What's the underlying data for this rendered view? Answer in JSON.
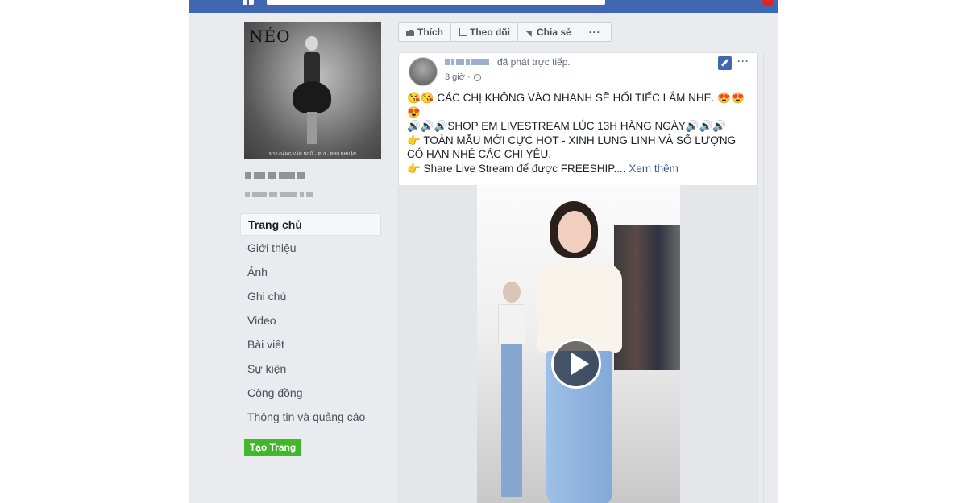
{
  "header": {
    "search_placeholder": ""
  },
  "left_column": {
    "profile_logo_text": "NÉO",
    "profile_caption": "9/10 ĐẶNG VĂN NGỮ · P10 · PHÚ NHUẬN",
    "nav_items": [
      {
        "label": "Trang chủ",
        "active": true
      },
      {
        "label": "Giới thiệu",
        "active": false
      },
      {
        "label": "Ảnh",
        "active": false
      },
      {
        "label": "Ghi chú",
        "active": false
      },
      {
        "label": "Video",
        "active": false
      },
      {
        "label": "Bài viết",
        "active": false
      },
      {
        "label": "Sự kiện",
        "active": false
      },
      {
        "label": "Cộng đồng",
        "active": false
      },
      {
        "label": "Thông tin và quảng cáo",
        "active": false
      }
    ],
    "create_page_button": "Tạo Trang"
  },
  "action_bar": {
    "like": "Thích",
    "follow": "Theo dõi",
    "share": "Chia sẻ",
    "more": "···"
  },
  "post": {
    "action_text": "đã phát trực tiếp.",
    "time": "3 giờ ·",
    "more": "···",
    "lines": [
      "😘😘 CÁC CHỊ KHÔNG VÀO NHANH SẼ HỐI TIẾC LẮM NHE. 😍😍😍",
      "🔊🔊🔊SHOP EM LIVESTREAM LÚC 13H HÀNG NGÀY🔊🔊🔊",
      "👉 TOÀN MẪU MỚI CỰC HOT - XINH LUNG LINH VÀ SỐ LƯỢNG CÓ HẠN NHÉ CÁC CHỊ YÊU.",
      "👉 Share Live Stream để được FREESHIP...."
    ],
    "see_more": "Xem thêm"
  },
  "colors": {
    "brand_blue": "#4267b2",
    "page_bg": "#e9ebee",
    "create_green": "#42b72a",
    "link_blue": "#385898"
  }
}
